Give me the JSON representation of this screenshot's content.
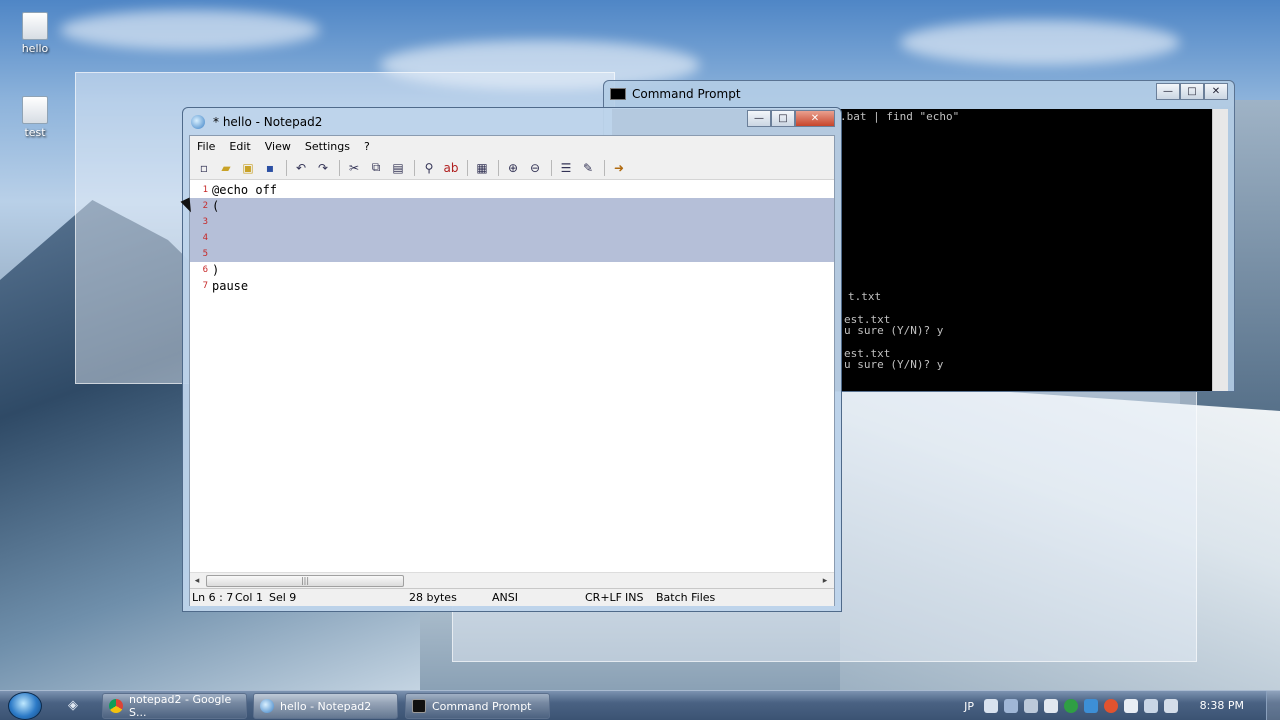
{
  "desktop": {
    "icons": [
      {
        "label": "hello"
      },
      {
        "label": "test"
      }
    ]
  },
  "cmd_window": {
    "title": "Command Prompt",
    "lines": [
      ".bat | find \"echo\"",
      "t.txt",
      "est.txt",
      "u sure (Y/N)? y",
      "est.txt",
      "u sure (Y/N)? y"
    ]
  },
  "notepad": {
    "title": "* hello - Notepad2",
    "menu": [
      "File",
      "Edit",
      "View",
      "Settings",
      "?"
    ],
    "lines": [
      {
        "num": "1",
        "text": "@echo off",
        "selected": false
      },
      {
        "num": "2",
        "text": "(",
        "selected": true
      },
      {
        "num": "3",
        "text": "",
        "selected": true
      },
      {
        "num": "4",
        "text": "",
        "selected": true
      },
      {
        "num": "5",
        "text": "",
        "selected": true
      },
      {
        "num": "6",
        "text": ")",
        "selected": false
      },
      {
        "num": "7",
        "text": "pause",
        "selected": false
      }
    ],
    "status": {
      "position": "Ln 6 : 7",
      "col": "Col 1",
      "sel": "Sel 9",
      "size": "28 bytes",
      "encoding": "ANSI",
      "eol": "CR+LF",
      "mode": "INS",
      "scheme": "Batch Files"
    }
  },
  "taskbar": {
    "tasks": [
      {
        "label": "notepad2 - Google S..."
      },
      {
        "label": "hello - Notepad2"
      },
      {
        "label": "Command Prompt"
      }
    ],
    "tray_lang": "JP",
    "clock": "8:38 PM"
  }
}
